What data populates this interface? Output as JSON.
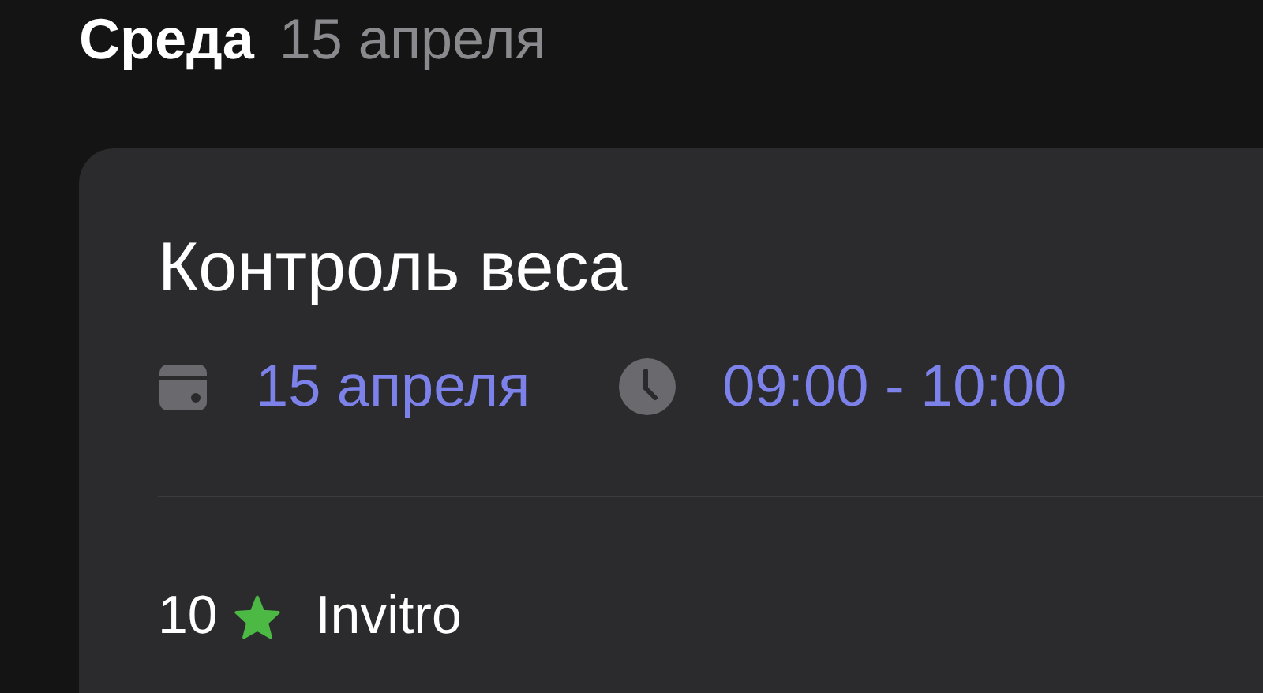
{
  "day": {
    "weekday": "Среда",
    "date": "15 апреля"
  },
  "event": {
    "title": "Контроль веса",
    "date": "15 апреля",
    "time": "09:00 - 10:00",
    "rating": "10",
    "provider": "Invitro"
  }
}
